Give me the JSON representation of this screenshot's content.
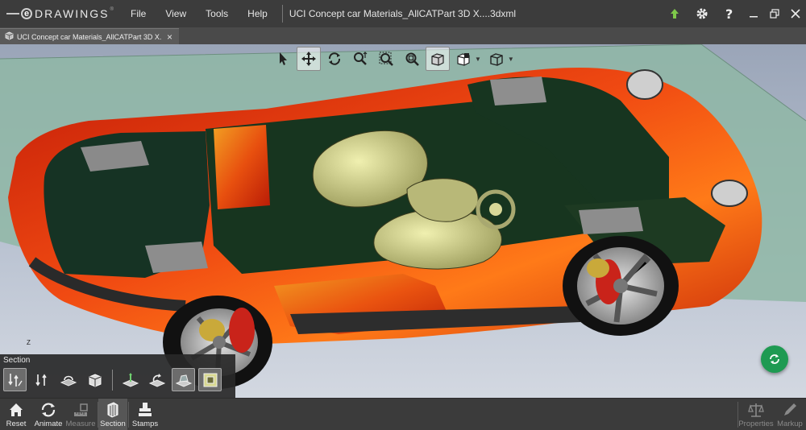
{
  "app": {
    "logo_text": "DRAWINGS",
    "logo_letter": "e",
    "logo_tm": "®",
    "menu": [
      "File",
      "View",
      "Tools",
      "Help"
    ],
    "document_title": "UCI Concept car Materials_AllCATPart 3D X....3dxml"
  },
  "tab": {
    "label": "UCI Concept car Materials_AllCATPart 3D X...",
    "close": "×"
  },
  "viewport_toolbar": {
    "tools": [
      "select-icon",
      "pan-icon",
      "rotate-icon",
      "zoom-icon",
      "zoom-to-area-icon",
      "zoom-to-fit-icon",
      "shaded-display-icon",
      "view-orientation-icon",
      "display-style-icon"
    ],
    "active": "pan-icon"
  },
  "triad": {
    "axis_label": "Z"
  },
  "section_panel": {
    "title": "Section",
    "tools": [
      "section-flip-icon",
      "section-cap-icon",
      "section-plane-icon",
      "section-box-icon",
      "section-plane-x-icon",
      "section-plane-y-icon",
      "section-plane-z-icon",
      "section-show-plane-icon"
    ]
  },
  "bottom_bar": {
    "buttons": [
      {
        "label": "Reset",
        "icon": "home-icon",
        "enabled": true
      },
      {
        "label": "Animate",
        "icon": "animate-icon",
        "enabled": true
      },
      {
        "label": "Measure",
        "icon": "measure-icon",
        "enabled": false
      },
      {
        "label": "Section",
        "icon": "section-icon",
        "enabled": true,
        "active": true
      },
      {
        "label": "Stamps",
        "icon": "stamps-icon",
        "enabled": true
      },
      {
        "label": "Properties",
        "icon": "properties-icon",
        "enabled": false
      },
      {
        "label": "Markup",
        "icon": "markup-icon",
        "enabled": false
      }
    ]
  },
  "colors": {
    "titlebar": "#3c3c3c",
    "car_body": "#e8380c",
    "interior": "#1c3a24",
    "seats": "#cfcf8a",
    "section_plane": "#8fb8a8",
    "sync_button": "#1e9a52"
  }
}
